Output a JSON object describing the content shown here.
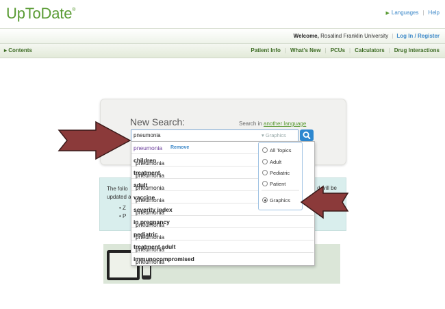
{
  "header": {
    "logo": "UpToDate",
    "logo_mark": "®",
    "languages_link": "Languages",
    "help_link": "Help"
  },
  "welcome_bar": {
    "welcome_label": "Welcome,",
    "institution": "Rosalind Franklin University",
    "login_link": "Log In / Register"
  },
  "nav": {
    "contents": "Contents",
    "links": [
      "Patient Info",
      "What's New",
      "PCUs",
      "Calculators",
      "Drug Interactions"
    ]
  },
  "search": {
    "heading": "New Search:",
    "search_in_label": "Search in",
    "another_language_link": "another language",
    "query": "pneumonia",
    "filter_selected": "Graphics",
    "filter_options": [
      "All Topics",
      "Adult",
      "Pediatric",
      "Patient",
      "Graphics"
    ]
  },
  "suggestions": {
    "remove_label": "Remove",
    "items": [
      {
        "base": "pneumonia",
        "suffix": ""
      },
      {
        "base": "pneumonia",
        "suffix": "children"
      },
      {
        "base": "pneumonia",
        "suffix": "treatment"
      },
      {
        "base": "pneumonia",
        "suffix": "adult"
      },
      {
        "base": "pneumonia",
        "suffix": "vaccine"
      },
      {
        "base": "pneumonia",
        "suffix": "severity index"
      },
      {
        "base": "pneumonia",
        "suffix": "in pregnancy"
      },
      {
        "base": "pneumonia",
        "suffix": "pediatric"
      },
      {
        "base": "pneumonia",
        "suffix": "treatment adult"
      },
      {
        "base": "pneumonia",
        "suffix": "immunocompromised"
      }
    ]
  },
  "info_box": {
    "line1_start": "The follo",
    "line1_end": "d will be",
    "line2_start": "updated a",
    "bullet1": "Z",
    "bullet2": "P"
  },
  "colors": {
    "brand_green": "#5a9b34",
    "link_blue": "#3a87c8",
    "arrow_red": "#8b3a3a"
  }
}
